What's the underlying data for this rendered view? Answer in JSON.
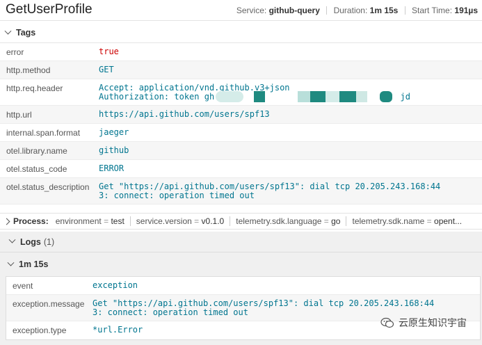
{
  "header": {
    "title": "GetUserProfile",
    "service_label": "Service:",
    "service_value": "github-query",
    "duration_label": "Duration:",
    "duration_value": "1m 15s",
    "start_label": "Start Time:",
    "start_value": "191µs"
  },
  "tags": {
    "label": "Tags",
    "rows": [
      {
        "key": "error",
        "value": "true"
      },
      {
        "key": "http.method",
        "value": "GET"
      },
      {
        "key": "http.req.header",
        "value": "Accept: application/vnd.github.v3+json\nAuthorization: token gh                                     jd"
      },
      {
        "key": "http.url",
        "value": "https://api.github.com/users/spf13"
      },
      {
        "key": "internal.span.format",
        "value": "jaeger"
      },
      {
        "key": "otel.library.name",
        "value": "github"
      },
      {
        "key": "otel.status_code",
        "value": "ERROR"
      },
      {
        "key": "otel.status_description",
        "value": "Get \"https://api.github.com/users/spf13\": dial tcp 20.205.243.168:44\n3: connect: operation timed out"
      }
    ]
  },
  "process": {
    "label": "Process:",
    "items": [
      {
        "key": "environment",
        "eq": "=",
        "value": "test"
      },
      {
        "key": "service.version",
        "eq": "=",
        "value": "v0.1.0"
      },
      {
        "key": "telemetry.sdk.language",
        "eq": "=",
        "value": "go"
      },
      {
        "key": "telemetry.sdk.name",
        "eq": "=",
        "value": "opent..."
      }
    ]
  },
  "logs": {
    "label": "Logs",
    "count": "(1)",
    "entry_time": "1m 15s",
    "rows": [
      {
        "key": "event",
        "value": "exception"
      },
      {
        "key": "exception.message",
        "value": "Get \"https://api.github.com/users/spf13\": dial tcp 20.205.243.168:44\n3: connect: operation timed out"
      },
      {
        "key": "exception.type",
        "value": "*url.Error"
      }
    ]
  },
  "watermark": {
    "text": "云原生知识宇宙"
  },
  "colors": {
    "value": "#00758f",
    "error": "#cc0000",
    "redaction": "#1f8a80"
  }
}
